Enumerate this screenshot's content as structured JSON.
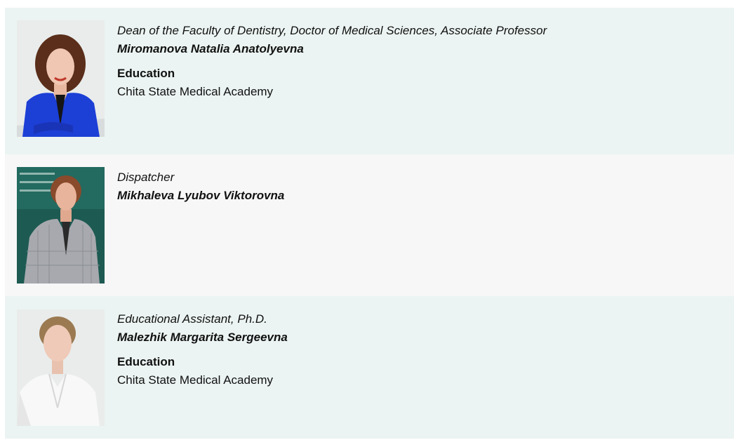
{
  "staff": [
    {
      "position": "Dean of the Faculty of Dentistry, Doctor of Medical Sciences, Associate Professor",
      "name": "Miromanova Natalia Anatolyevna",
      "education_label": "Education",
      "education": "Chita State Medical Academy",
      "photo": "portrait-photo"
    },
    {
      "position": "Dispatcher",
      "name": "Mikhaleva Lyubov Viktorovna",
      "photo": "portrait-photo"
    },
    {
      "position": "Educational Assistant, Ph.D.",
      "name": "Malezhik Margarita Sergeevna",
      "education_label": "Education",
      "education": "Chita State Medical Academy",
      "photo": "portrait-photo"
    }
  ]
}
